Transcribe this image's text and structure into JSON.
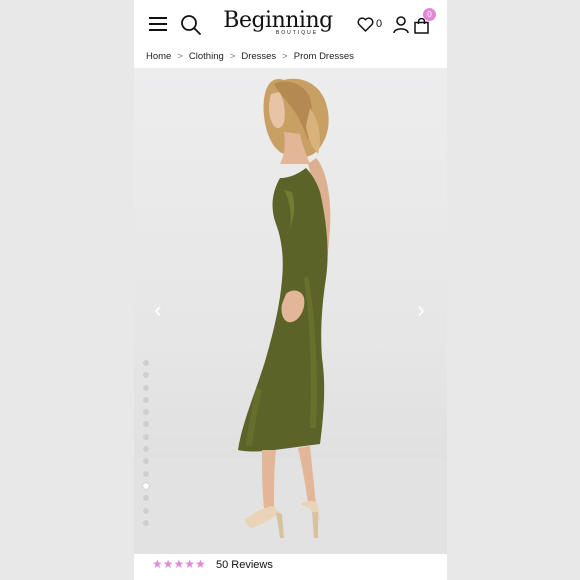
{
  "header": {
    "logo_main": "Beginning",
    "logo_sub": "BOUTIQUE",
    "wishlist_count": "0",
    "bag_count": "0",
    "accent_color": "#e08ad6"
  },
  "breadcrumb": {
    "items": [
      "Home",
      "Clothing",
      "Dresses",
      "Prom Dresses"
    ],
    "separator": ">"
  },
  "gallery": {
    "prev_arrow": "‹",
    "next_arrow": "›",
    "total_images": 14,
    "active_index": 10,
    "icons": [
      "hamburger-menu-icon",
      "search-icon",
      "heart-icon",
      "user-icon",
      "shopping-bag-icon"
    ]
  },
  "reviews": {
    "stars": "★★★★★",
    "rating": 5,
    "label": "50 Reviews"
  }
}
